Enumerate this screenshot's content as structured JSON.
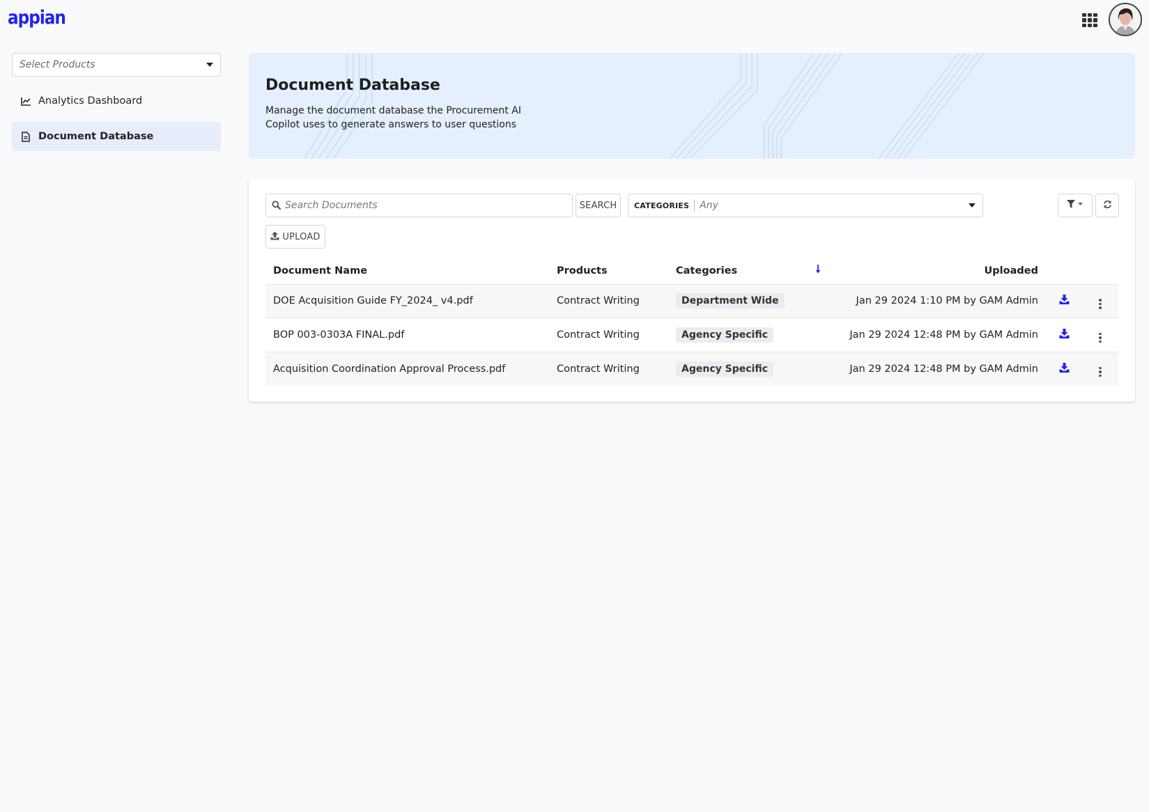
{
  "app": {
    "logo_text": "appian",
    "brand_color": "#2322f0"
  },
  "header": {
    "apps_icon": "grid-icon",
    "avatar": "user-avatar"
  },
  "sidebar": {
    "product_select": {
      "placeholder": "Select Products",
      "icon": "caret-down-icon"
    },
    "items": [
      {
        "label": "Analytics Dashboard",
        "icon": "chart-line-icon",
        "active": false
      },
      {
        "label": "Document Database",
        "icon": "document-icon",
        "active": true
      }
    ]
  },
  "banner": {
    "title": "Document Database",
    "description": "Manage the document database the Procurement AI Copilot uses to generate answers to user questions"
  },
  "toolbar": {
    "search_placeholder": "Search Documents",
    "search_value": "",
    "search_button": "SEARCH",
    "categories_label": "CATEGORIES",
    "categories_value": "Any",
    "upload_button": "UPLOAD",
    "filter_icon": "filter-icon",
    "refresh_icon": "refresh-icon"
  },
  "table": {
    "columns": {
      "name": "Document Name",
      "products": "Products",
      "categories": "Categories",
      "sort_icon": "sort-arrow-down-icon",
      "uploaded": "Uploaded"
    },
    "rows": [
      {
        "name": "DOE Acquisition Guide FY_2024_ v4.pdf",
        "products": "Contract Writing",
        "category": "Department Wide",
        "uploaded": "Jan 29 2024 1:10 PM by GAM Admin"
      },
      {
        "name": "BOP 003-0303A FINAL.pdf",
        "products": "Contract Writing",
        "category": "Agency Specific",
        "uploaded": "Jan 29 2024 12:48 PM by GAM Admin"
      },
      {
        "name": "Acquisition Coordination Approval Process.pdf",
        "products": "Contract Writing",
        "category": "Agency Specific",
        "uploaded": "Jan 29 2024 12:48 PM by GAM Admin"
      }
    ]
  }
}
